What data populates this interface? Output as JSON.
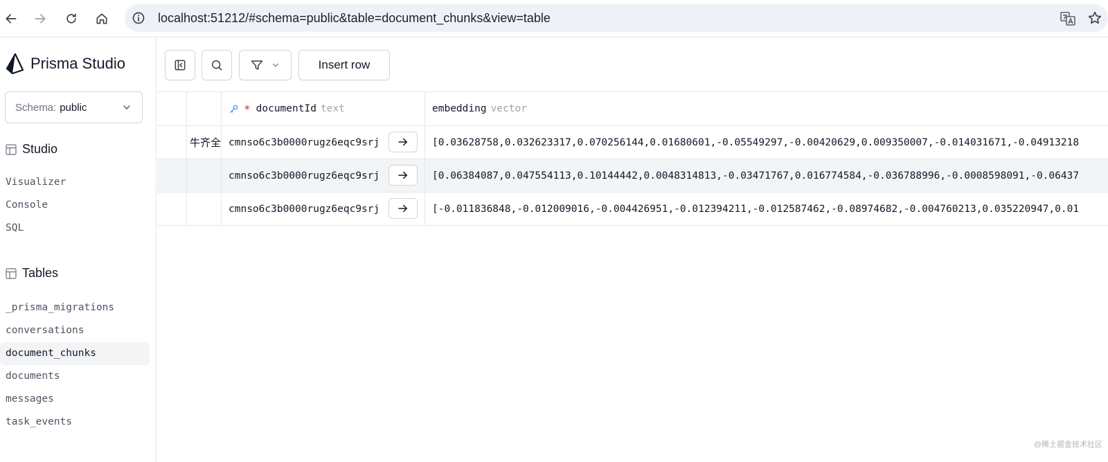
{
  "browser": {
    "url": "localhost:51212/#schema=public&table=document_chunks&view=table"
  },
  "sidebar": {
    "brand": "Prisma Studio",
    "schema_label": "Schema:",
    "schema_value": "public",
    "studio_heading": "Studio",
    "studio_items": [
      "Visualizer",
      "Console",
      "SQL"
    ],
    "tables_heading": "Tables",
    "tables": [
      "_prisma_migrations",
      "conversations",
      "document_chunks",
      "documents",
      "messages",
      "task_events"
    ],
    "active_table": "document_chunks"
  },
  "toolbar": {
    "insert_label": "Insert row"
  },
  "table": {
    "columns": [
      {
        "name": "documentId",
        "type": "text"
      },
      {
        "name": "embedding",
        "type": "vector"
      }
    ],
    "rows": [
      {
        "partial": "牛齐全",
        "documentId": "cmnso6c3b0000rugz6eqc9srj",
        "embedding": "[0.03628758,0.032623317,0.070256144,0.01680601,-0.05549297,-0.00420629,0.009350007,-0.014031671,-0.04913218"
      },
      {
        "partial": "",
        "documentId": "cmnso6c3b0000rugz6eqc9srj",
        "embedding": "[0.06384087,0.047554113,0.10144442,0.0048314813,-0.03471767,0.016774584,-0.036788996,-0.0008598091,-0.06437"
      },
      {
        "partial": "",
        "documentId": "cmnso6c3b0000rugz6eqc9srj",
        "embedding": "[-0.011836848,-0.012009016,-0.004426951,-0.012394211,-0.012587462,-0.08974682,-0.004760213,0.035220947,0.01"
      }
    ]
  },
  "watermark": "@稀土掘金技术社区"
}
